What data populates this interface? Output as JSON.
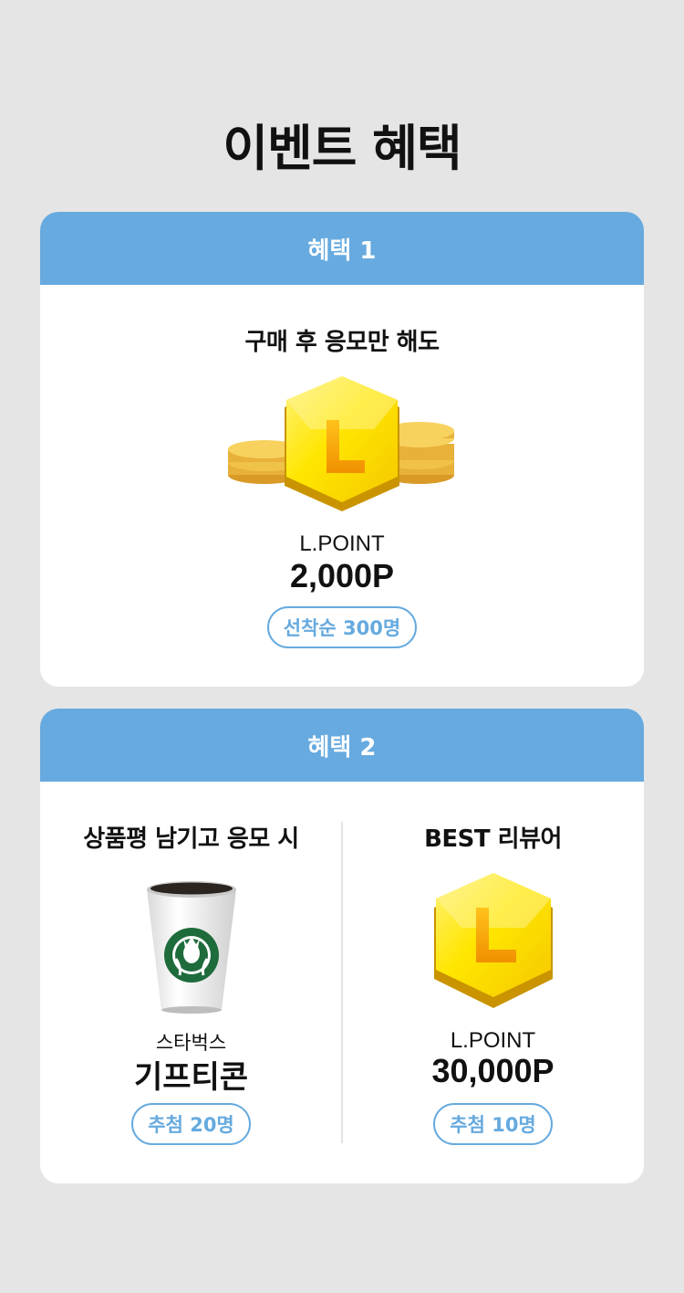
{
  "page": {
    "title": "이벤트 혜택"
  },
  "benefit1": {
    "header": "혜택 1",
    "headline": "구매 후 응모만 해도",
    "icon_letter": "L",
    "point_label": "L.POINT",
    "amount": "2,000P",
    "badge": "선착순 300명"
  },
  "benefit2": {
    "header": "혜택 2",
    "left": {
      "headline": "상품평 남기고 응모 시",
      "brand": "스타벅스",
      "prize": "기프티콘",
      "badge": "추첨 20명"
    },
    "right": {
      "headline": "BEST 리뷰어",
      "icon_letter": "L",
      "point_label": "L.POINT",
      "amount": "30,000P",
      "badge": "추첨 10명"
    }
  },
  "colors": {
    "background": "#e5e5e5",
    "header_blue": "#66aadf",
    "coin_yellow": "#ffe600",
    "coin_gold": "#e8b93c",
    "starbucks_green": "#1e6b3c"
  }
}
